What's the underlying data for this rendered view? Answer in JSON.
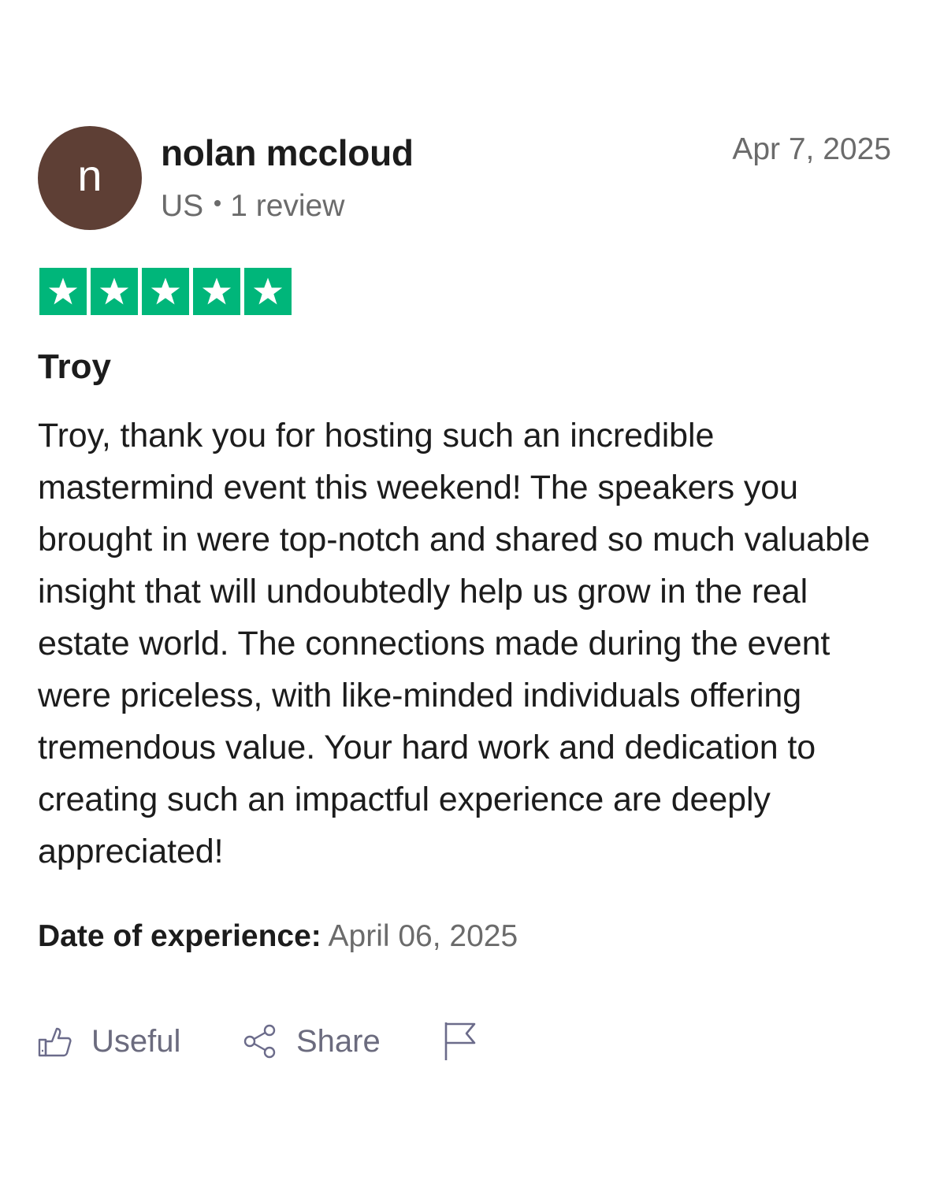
{
  "reviewer": {
    "avatar_letter": "n",
    "name": "nolan mccloud",
    "country": "US",
    "review_count": "1 review"
  },
  "review": {
    "date": "Apr 7, 2025",
    "rating": 5,
    "rating_max": 5,
    "title": "Troy",
    "body": "Troy, thank you for hosting such an incredible mastermind event this weekend! The speakers you brought in were top-notch and shared so much valuable insight that will undoubtedly help us grow in the real estate world. The connections made during the event were priceless, with like-minded individuals offering tremendous value. Your hard work and dedication to creating such an impactful experience are deeply appreciated!",
    "experience_label": "Date of experience:",
    "experience_date": "April 06, 2025"
  },
  "actions": {
    "useful_label": "Useful",
    "share_label": "Share"
  },
  "colors": {
    "avatar_bg": "#5e3f35",
    "star_green": "#00b67a",
    "muted_text": "#6b6b6b",
    "action_icon": "#6b6b8a"
  },
  "icons": {
    "useful": "thumbs-up-icon",
    "share": "share-icon",
    "report": "flag-icon",
    "star": "star-icon"
  }
}
